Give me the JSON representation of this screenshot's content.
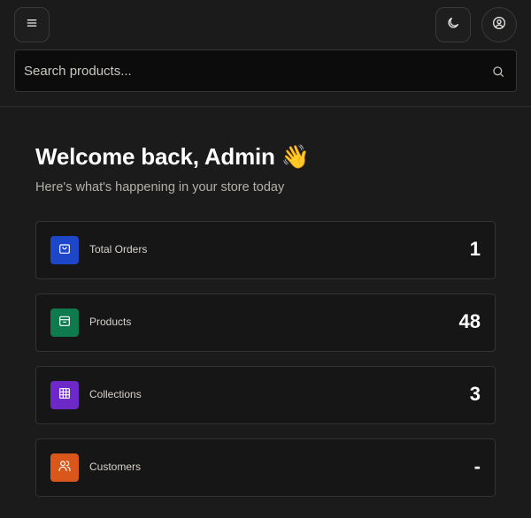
{
  "header": {
    "menu_icon": "hamburger-menu-icon",
    "theme_icon": "moon-icon",
    "profile_icon": "user-circle-icon"
  },
  "search": {
    "placeholder": "Search products...",
    "value": "",
    "icon": "search-icon"
  },
  "welcome": {
    "title": "Welcome back, Admin 👋",
    "subtitle": "Here's what's happening in your store today"
  },
  "stats": [
    {
      "label": "Total Orders",
      "value": "1",
      "icon": "shopping-bag-icon",
      "color": "#1d46c9"
    },
    {
      "label": "Products",
      "value": "48",
      "icon": "package-icon",
      "color": "#0f7a4e"
    },
    {
      "label": "Collections",
      "value": "3",
      "icon": "grid-icon",
      "color": "#6d28c8"
    },
    {
      "label": "Customers",
      "value": "-",
      "icon": "users-icon",
      "color": "#d9571a"
    }
  ],
  "colors": {
    "background": "#1c1b1b",
    "card_background": "#171616",
    "border": "#343332",
    "search_background": "#0d0c0c"
  }
}
